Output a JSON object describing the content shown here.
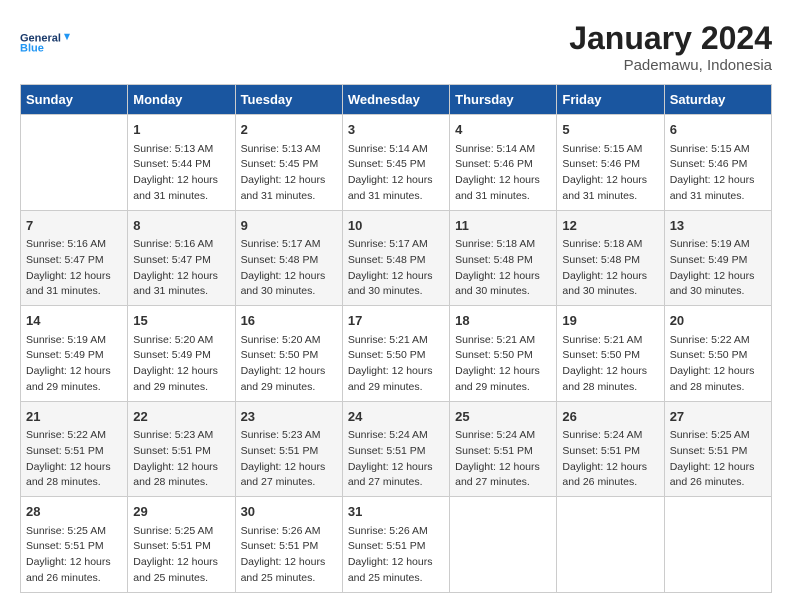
{
  "header": {
    "logo_line1": "General",
    "logo_line2": "Blue",
    "month": "January 2024",
    "location": "Pademawu, Indonesia"
  },
  "days_of_week": [
    "Sunday",
    "Monday",
    "Tuesday",
    "Wednesday",
    "Thursday",
    "Friday",
    "Saturday"
  ],
  "weeks": [
    [
      {
        "day": "",
        "info": ""
      },
      {
        "day": "1",
        "info": "Sunrise: 5:13 AM\nSunset: 5:44 PM\nDaylight: 12 hours\nand 31 minutes."
      },
      {
        "day": "2",
        "info": "Sunrise: 5:13 AM\nSunset: 5:45 PM\nDaylight: 12 hours\nand 31 minutes."
      },
      {
        "day": "3",
        "info": "Sunrise: 5:14 AM\nSunset: 5:45 PM\nDaylight: 12 hours\nand 31 minutes."
      },
      {
        "day": "4",
        "info": "Sunrise: 5:14 AM\nSunset: 5:46 PM\nDaylight: 12 hours\nand 31 minutes."
      },
      {
        "day": "5",
        "info": "Sunrise: 5:15 AM\nSunset: 5:46 PM\nDaylight: 12 hours\nand 31 minutes."
      },
      {
        "day": "6",
        "info": "Sunrise: 5:15 AM\nSunset: 5:46 PM\nDaylight: 12 hours\nand 31 minutes."
      }
    ],
    [
      {
        "day": "7",
        "info": "Sunrise: 5:16 AM\nSunset: 5:47 PM\nDaylight: 12 hours\nand 31 minutes."
      },
      {
        "day": "8",
        "info": "Sunrise: 5:16 AM\nSunset: 5:47 PM\nDaylight: 12 hours\nand 31 minutes."
      },
      {
        "day": "9",
        "info": "Sunrise: 5:17 AM\nSunset: 5:48 PM\nDaylight: 12 hours\nand 30 minutes."
      },
      {
        "day": "10",
        "info": "Sunrise: 5:17 AM\nSunset: 5:48 PM\nDaylight: 12 hours\nand 30 minutes."
      },
      {
        "day": "11",
        "info": "Sunrise: 5:18 AM\nSunset: 5:48 PM\nDaylight: 12 hours\nand 30 minutes."
      },
      {
        "day": "12",
        "info": "Sunrise: 5:18 AM\nSunset: 5:48 PM\nDaylight: 12 hours\nand 30 minutes."
      },
      {
        "day": "13",
        "info": "Sunrise: 5:19 AM\nSunset: 5:49 PM\nDaylight: 12 hours\nand 30 minutes."
      }
    ],
    [
      {
        "day": "14",
        "info": "Sunrise: 5:19 AM\nSunset: 5:49 PM\nDaylight: 12 hours\nand 29 minutes."
      },
      {
        "day": "15",
        "info": "Sunrise: 5:20 AM\nSunset: 5:49 PM\nDaylight: 12 hours\nand 29 minutes."
      },
      {
        "day": "16",
        "info": "Sunrise: 5:20 AM\nSunset: 5:50 PM\nDaylight: 12 hours\nand 29 minutes."
      },
      {
        "day": "17",
        "info": "Sunrise: 5:21 AM\nSunset: 5:50 PM\nDaylight: 12 hours\nand 29 minutes."
      },
      {
        "day": "18",
        "info": "Sunrise: 5:21 AM\nSunset: 5:50 PM\nDaylight: 12 hours\nand 29 minutes."
      },
      {
        "day": "19",
        "info": "Sunrise: 5:21 AM\nSunset: 5:50 PM\nDaylight: 12 hours\nand 28 minutes."
      },
      {
        "day": "20",
        "info": "Sunrise: 5:22 AM\nSunset: 5:50 PM\nDaylight: 12 hours\nand 28 minutes."
      }
    ],
    [
      {
        "day": "21",
        "info": "Sunrise: 5:22 AM\nSunset: 5:51 PM\nDaylight: 12 hours\nand 28 minutes."
      },
      {
        "day": "22",
        "info": "Sunrise: 5:23 AM\nSunset: 5:51 PM\nDaylight: 12 hours\nand 28 minutes."
      },
      {
        "day": "23",
        "info": "Sunrise: 5:23 AM\nSunset: 5:51 PM\nDaylight: 12 hours\nand 27 minutes."
      },
      {
        "day": "24",
        "info": "Sunrise: 5:24 AM\nSunset: 5:51 PM\nDaylight: 12 hours\nand 27 minutes."
      },
      {
        "day": "25",
        "info": "Sunrise: 5:24 AM\nSunset: 5:51 PM\nDaylight: 12 hours\nand 27 minutes."
      },
      {
        "day": "26",
        "info": "Sunrise: 5:24 AM\nSunset: 5:51 PM\nDaylight: 12 hours\nand 26 minutes."
      },
      {
        "day": "27",
        "info": "Sunrise: 5:25 AM\nSunset: 5:51 PM\nDaylight: 12 hours\nand 26 minutes."
      }
    ],
    [
      {
        "day": "28",
        "info": "Sunrise: 5:25 AM\nSunset: 5:51 PM\nDaylight: 12 hours\nand 26 minutes."
      },
      {
        "day": "29",
        "info": "Sunrise: 5:25 AM\nSunset: 5:51 PM\nDaylight: 12 hours\nand 25 minutes."
      },
      {
        "day": "30",
        "info": "Sunrise: 5:26 AM\nSunset: 5:51 PM\nDaylight: 12 hours\nand 25 minutes."
      },
      {
        "day": "31",
        "info": "Sunrise: 5:26 AM\nSunset: 5:51 PM\nDaylight: 12 hours\nand 25 minutes."
      },
      {
        "day": "",
        "info": ""
      },
      {
        "day": "",
        "info": ""
      },
      {
        "day": "",
        "info": ""
      }
    ]
  ]
}
